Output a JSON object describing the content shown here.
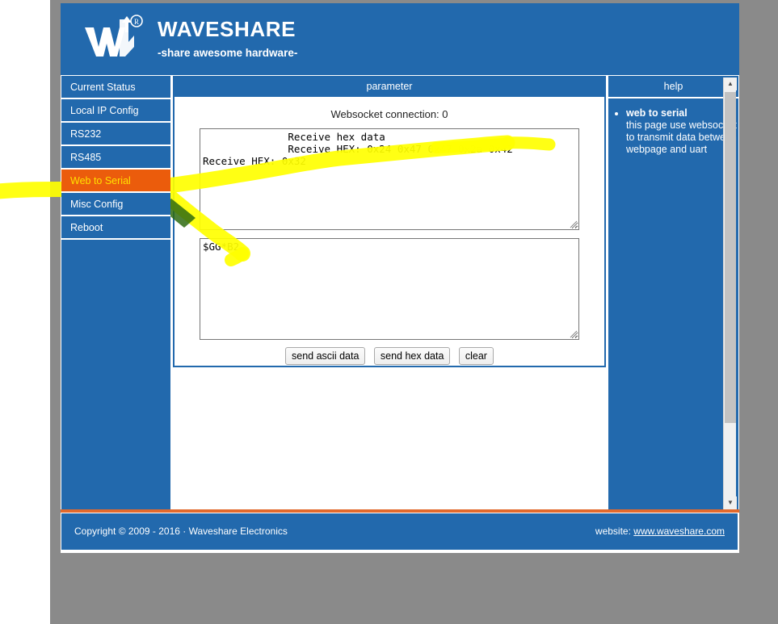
{
  "brand": {
    "title": "WAVESHARE",
    "tagline": "-share awesome hardware-",
    "logo_icon": "waveshare-logo-icon"
  },
  "sidebar": {
    "items": [
      {
        "label": "Current Status",
        "active": false
      },
      {
        "label": "Local IP Config",
        "active": false
      },
      {
        "label": "RS232",
        "active": false
      },
      {
        "label": "RS485",
        "active": false
      },
      {
        "label": "Web to Serial",
        "active": true
      },
      {
        "label": "Misc Config",
        "active": false
      },
      {
        "label": "Reboot",
        "active": false
      }
    ]
  },
  "parameter_panel": {
    "header": "parameter",
    "websocket_status": "Websocket connection: 0",
    "receive_textarea": {
      "value": "              Receive hex data\n              Receive HEX: 0x24 0x47 0x47 0x2a 0x42\nReceive HEX: 0x32",
      "placeholder": ""
    },
    "send_textarea": {
      "value": "$GG*B2",
      "placeholder": ""
    },
    "buttons": [
      {
        "label": "send ascii data",
        "name": "send-ascii-data-button"
      },
      {
        "label": "send hex data",
        "name": "send-hex-data-button"
      },
      {
        "label": "clear",
        "name": "clear-button"
      }
    ]
  },
  "help_panel": {
    "header": "help",
    "entries": [
      {
        "title": "web to serial",
        "text": "this page use websocket to transmit data between webpage and uart"
      }
    ]
  },
  "footer": {
    "copyright": "Copyright © 2009 - 2016 · Waveshare Electronics",
    "website_label": "website:",
    "website_url": "www.waveshare.com"
  },
  "scrollbar": {
    "up_arrow": "▲",
    "down_arrow": "▼"
  },
  "colors": {
    "brand_blue": "#2269ad",
    "active_orange": "#eb5c0c",
    "active_text": "#ffe000",
    "footer_rule": "#e2692c",
    "highlighter": "#ffff00",
    "page_background": "#8a8a8a"
  }
}
